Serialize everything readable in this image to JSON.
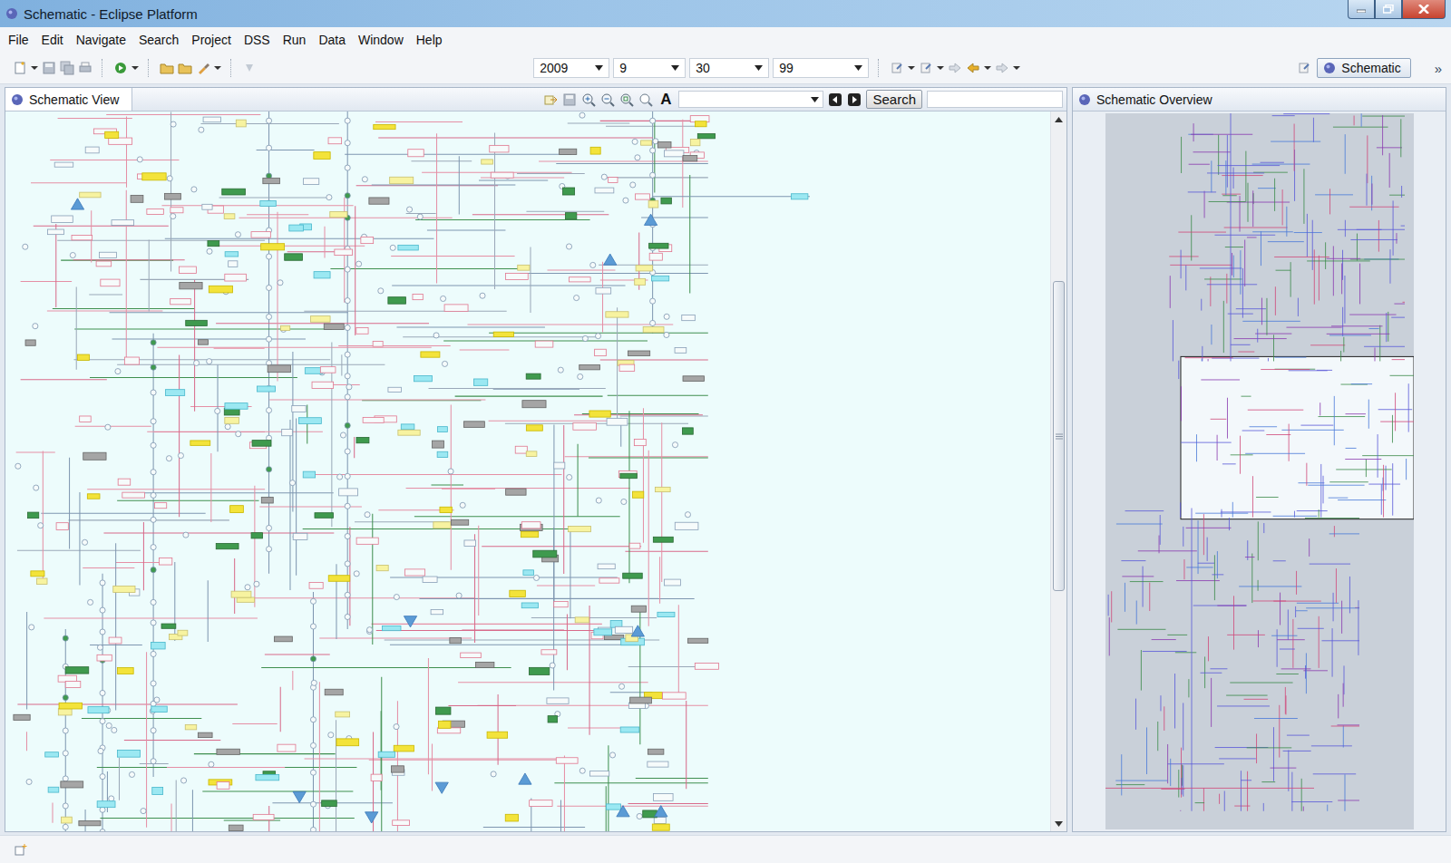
{
  "window": {
    "title": "Schematic - Eclipse Platform"
  },
  "menu": [
    "File",
    "Edit",
    "Navigate",
    "Search",
    "Project",
    "DSS",
    "Run",
    "Data",
    "Window",
    "Help"
  ],
  "toolbar": {
    "combos": [
      {
        "value": "2009"
      },
      {
        "value": "9"
      },
      {
        "value": "30"
      },
      {
        "value": "99"
      }
    ],
    "perspective": {
      "label": "Schematic",
      "selected": true
    },
    "overflow": "»"
  },
  "schematic_view": {
    "tab": {
      "label": "Schematic View",
      "selected": true
    },
    "font_button": "A",
    "combo": {
      "value": ""
    },
    "search_button": "Search",
    "search_field": {
      "value": ""
    }
  },
  "overview": {
    "tab": {
      "label": "Schematic Overview",
      "selected": false
    }
  }
}
